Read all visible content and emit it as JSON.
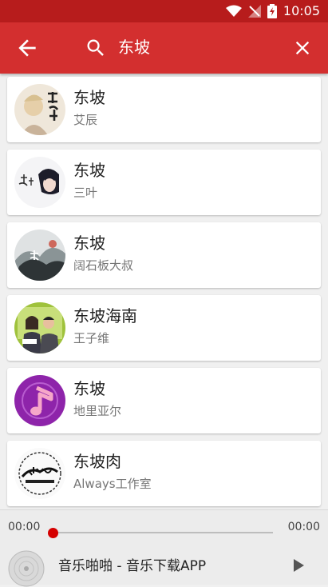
{
  "status_bar": {
    "time": "10:05"
  },
  "search": {
    "query": "东坡"
  },
  "results": [
    {
      "title": "东坡",
      "artist": "艾辰",
      "art": "seal-art"
    },
    {
      "title": "东坡",
      "artist": "三叶",
      "art": "anime-art"
    },
    {
      "title": "东坡",
      "artist": "阔石板大叔",
      "art": "ink-art"
    },
    {
      "title": "东坡海南",
      "artist": "王子维",
      "art": "duo-art"
    },
    {
      "title": "东坡",
      "artist": "地里亚尔",
      "art": "note-art"
    },
    {
      "title": "东坡肉",
      "artist": "Always工作室",
      "art": "always-art"
    }
  ],
  "player": {
    "time_current": "00:00",
    "time_total": "00:00",
    "progress": 0,
    "now_playing": "音乐啪啪 - 音乐下载APP"
  },
  "colors": {
    "accent": "#d32f2f",
    "status_bar": "#b71c1c",
    "progress_thumb": "#d50000"
  }
}
